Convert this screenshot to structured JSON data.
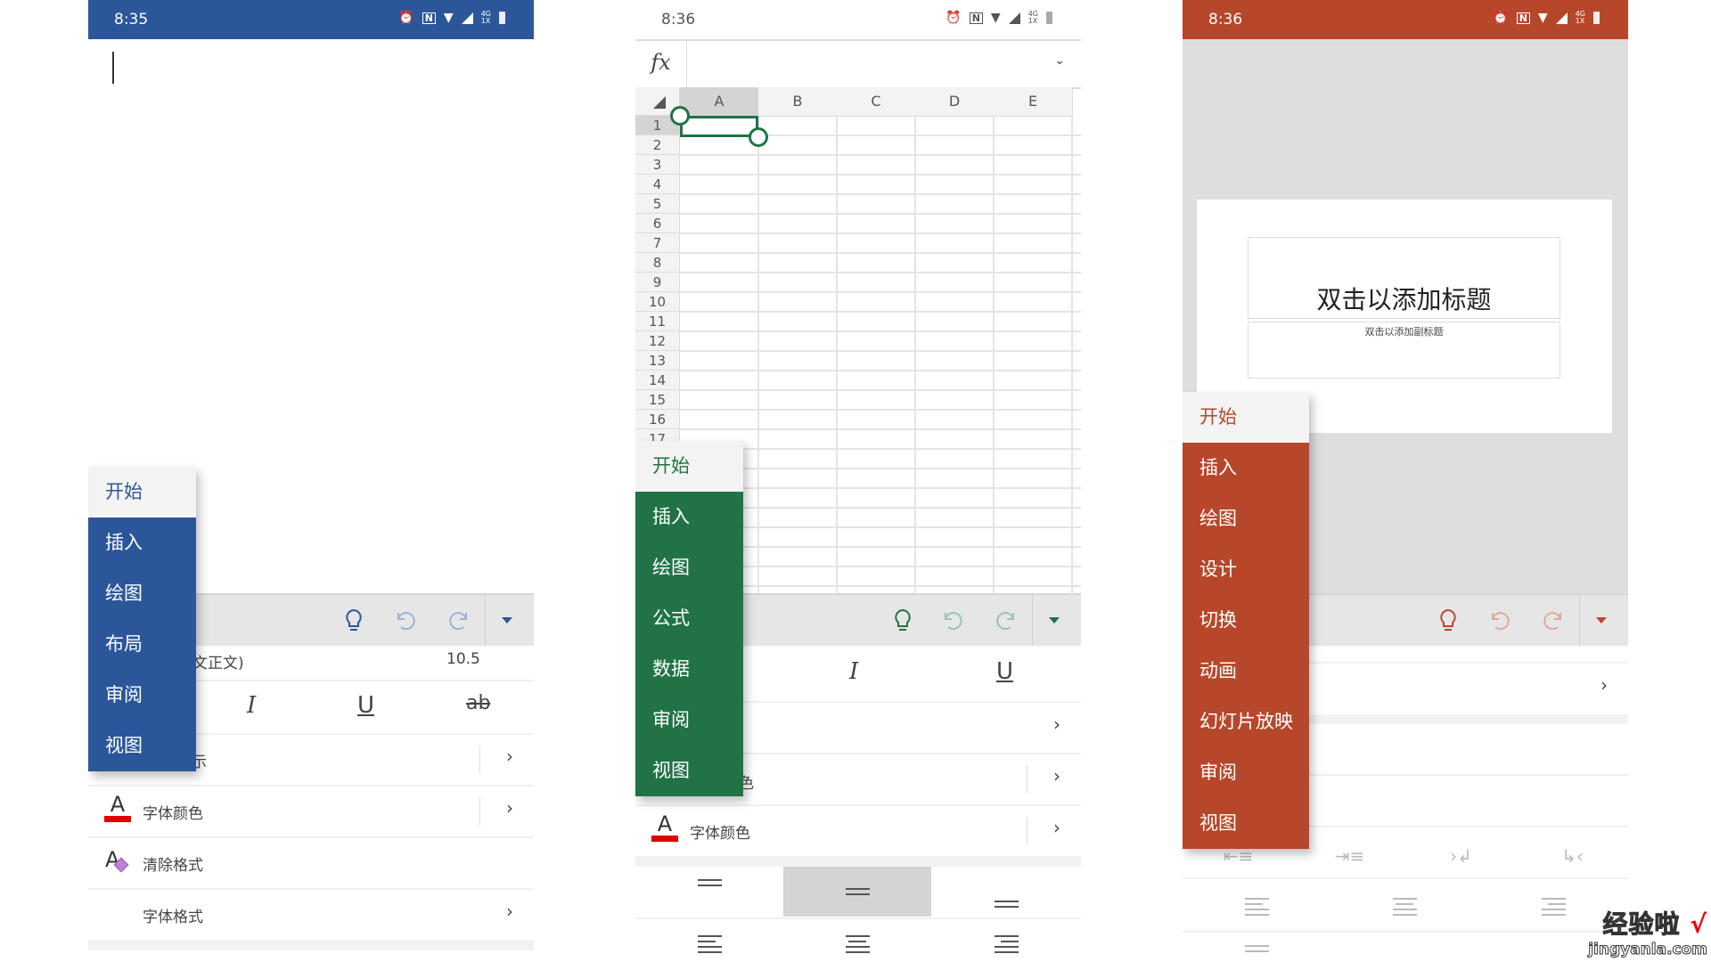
{
  "word": {
    "status": {
      "time": "8:35",
      "icons": [
        "alarm-icon",
        "nfc-icon",
        "wifi-icon",
        "signal-icon",
        "4g-1x-signal-icon",
        "battery-icon"
      ],
      "net_top": "4G",
      "net_bottom": "1X"
    },
    "theme_color": "#2b579a",
    "tabs": [
      {
        "label": "开始",
        "active": true
      },
      {
        "label": "插入"
      },
      {
        "label": "绘图"
      },
      {
        "label": "布局"
      },
      {
        "label": "审阅"
      },
      {
        "label": "视图"
      }
    ],
    "toolbar": {
      "icons": [
        "lightbulb-icon",
        "undo-icon",
        "redo-icon",
        "collapse-ribbon-icon"
      ]
    },
    "font_name": "(中文正文)",
    "font_name_visible": "文正文)",
    "font_size": "10.5",
    "format_buttons": [
      "I",
      "U",
      "ab"
    ],
    "rows": [
      {
        "label_visible": "示",
        "chevron": "›"
      },
      {
        "label": "字体颜色",
        "chevron": "›"
      },
      {
        "label": "清除格式"
      },
      {
        "label": "字体格式",
        "chevron": "›"
      }
    ]
  },
  "excel": {
    "status": {
      "time": "8:36",
      "net_top": "4G",
      "net_bottom": "1X"
    },
    "theme_color": "#217346",
    "formula_bar": {
      "label": "fx",
      "value": ""
    },
    "columns": [
      "A",
      "B",
      "C",
      "D",
      "E"
    ],
    "rows": [
      "1",
      "2",
      "3",
      "4",
      "5",
      "6",
      "7",
      "8",
      "9",
      "10",
      "11",
      "12",
      "13",
      "14",
      "15",
      "16",
      "17"
    ],
    "selected_cell": "A1",
    "tabs": [
      {
        "label": "开始",
        "active": true
      },
      {
        "label": "插入"
      },
      {
        "label": "绘图"
      },
      {
        "label": "公式"
      },
      {
        "label": "数据"
      },
      {
        "label": "审阅"
      },
      {
        "label": "视图"
      }
    ],
    "format_buttons": [
      "I",
      "U"
    ],
    "rows_panel": [
      {
        "chevron": "›"
      },
      {
        "label_visible": "色",
        "chevron": "›"
      },
      {
        "label": "字体颜色",
        "chevron": "›"
      }
    ],
    "vertical_align": [
      "top",
      "middle",
      "bottom"
    ],
    "vertical_align_selected": "middle",
    "horizontal_align": [
      "left",
      "center",
      "right"
    ]
  },
  "ppt": {
    "status": {
      "time": "8:36",
      "net_top": "4G",
      "net_bottom": "1X"
    },
    "theme_color": "#b7472a",
    "slide": {
      "title_placeholder": "双击以添加标题",
      "subtitle_placeholder": "双击以添加副标题"
    },
    "tabs": [
      {
        "label": "开始",
        "active": true
      },
      {
        "label": "插入"
      },
      {
        "label": "绘图"
      },
      {
        "label": "设计"
      },
      {
        "label": "切换"
      },
      {
        "label": "动画"
      },
      {
        "label": "幻灯片放映"
      },
      {
        "label": "审阅"
      },
      {
        "label": "视图"
      }
    ],
    "rows_panel": [
      {
        "chevron": "›"
      }
    ],
    "indent_buttons": [
      "decrease-indent-icon",
      "increase-indent-icon",
      "ltr-icon",
      "rtl-icon"
    ],
    "align_buttons": [
      "align-left",
      "align-center",
      "align-right"
    ]
  },
  "watermark": {
    "line1": "经验啦",
    "tick": "√",
    "line2": "jingyanla.com"
  }
}
